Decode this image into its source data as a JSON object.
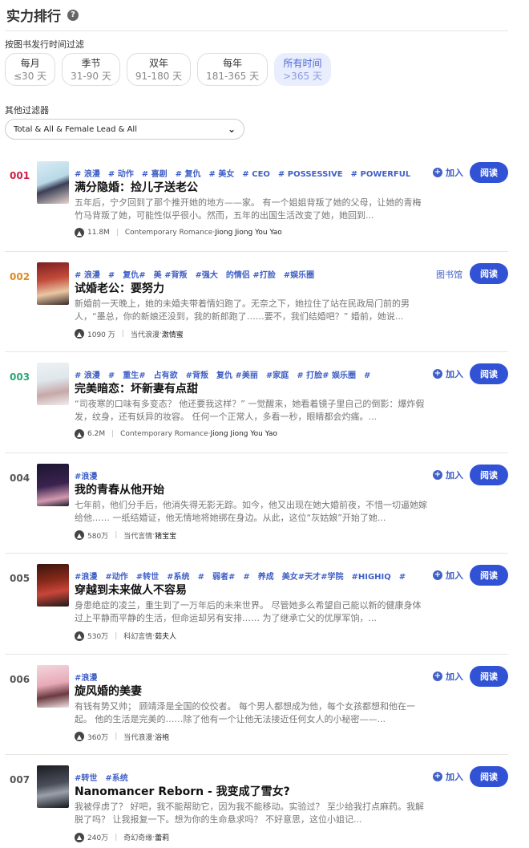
{
  "header": {
    "title": "实力排行",
    "help_icon": "?"
  },
  "time_filter": {
    "label": "按图书发行时间过滤",
    "options": [
      {
        "name": "每月",
        "range": "≤30 天",
        "active": false
      },
      {
        "name": "季节",
        "range": "31-90 天",
        "active": false
      },
      {
        "name": "双年",
        "range": "91-180 天",
        "active": false
      },
      {
        "name": "每年",
        "range": "181-365 天",
        "active": false
      },
      {
        "name": "所有时间",
        "range": ">365 天",
        "active": true
      }
    ]
  },
  "other_filter": {
    "label": "其他过滤器",
    "selected": "Total & All & Female Lead & All"
  },
  "books": [
    {
      "rank": "001",
      "rank_color": "#d0204a",
      "tags": [
        "# 浪漫",
        "# 动作",
        "# 喜剧",
        "# 复仇",
        "# 美女",
        "# CEO",
        "# POSSESSIVE",
        "# POWERFUL"
      ],
      "title": "满分隐婚：捡儿子送老公",
      "desc": "五年后，宁夕回到了那个推开她的地方——家。 有一个姐姐背叛了她的父母，让她的青梅竹马背叛了她，可能性似乎很小。然而，五年的出国生活改变了她，她回到...",
      "popularity": "11.8M",
      "genre": "Contemporary Romance",
      "author": "Jiong Jiong You Yao",
      "action": "加入",
      "read": "阅读"
    },
    {
      "rank": "002",
      "rank_color": "#e08a1e",
      "tags": [
        "# 浪漫",
        "#",
        "复仇#",
        "美 #背叛",
        "#强大",
        "的情侣 #打脸",
        "#娱乐圈"
      ],
      "title": "试婚老公：要努力",
      "desc": "新婚前一天晚上，她的未婚夫带着情妇跑了。无奈之下，她拉住了站在民政局门前的男人，“墨总，你的新娘还没到，我的新郎跑了……要不，我们结婚吧？” 婚前，她说...",
      "popularity": "1090 万",
      "genre": "当代浪漫",
      "author": "激情蜜",
      "action": "图书馆",
      "read": "阅读"
    },
    {
      "rank": "003",
      "rank_color": "#2aa876",
      "tags": [
        "# 浪漫",
        "#",
        "重生#",
        "占有欲",
        "#背叛",
        "复仇 #美丽",
        "#家庭",
        "# 打脸# 娱乐圈",
        "#"
      ],
      "title": "完美暗恋：坏新妻有点甜",
      "desc": "“司夜寒的口味有多变态？ 他还要我这样？” 一觉醒来，她看着镜子里自己的倒影：爆炸假发，纹身，还有妖异的妆容。 任何一个正常人，多看一秒，眼睛都会灼痛。...",
      "popularity": "6.2M",
      "genre": "Contemporary Romance",
      "author": "Jiong Jiong You Yao",
      "action": "加入",
      "read": "阅读"
    },
    {
      "rank": "004",
      "rank_color": "#555555",
      "tags": [
        "#浪漫"
      ],
      "title": "我的青春从他开始",
      "desc": "七年前，他们分手后，他消失得无影无踪。如今，他又出现在她大婚前夜，不惜一切逼她嫁给他…… 一纸结婚证，他无情地将她绑在身边。从此，这位“灰姑娘”开始了她...",
      "popularity": "580万",
      "genre": "当代言情",
      "author": "猪宝宝",
      "action": "加入",
      "read": "阅读"
    },
    {
      "rank": "005",
      "rank_color": "#555555",
      "tags": [
        "#浪漫",
        "#动作",
        "#转世",
        "#系统",
        "#",
        "弱者#",
        "#",
        "养成",
        "美女#天才#学院",
        "#HIGHIQ",
        "#"
      ],
      "title": "穿越到未来做人不容易",
      "desc": "身患绝症的凌兰，重生到了一万年后的未来世界。 尽管她多么希望自己能以新的健康身体过上平静而平静的生活，但命运却另有安排…… 为了继承亡父的优厚军饷，...",
      "popularity": "530万",
      "genre": "科幻言情",
      "author": "茹夫人",
      "action": "加入",
      "read": "阅读"
    },
    {
      "rank": "006",
      "rank_color": "#555555",
      "tags": [
        "#浪漫"
      ],
      "title": "旋风婚的美妻",
      "desc": "有钱有势又帅； 顾靖泽是全国的佼佼者。 每个男人都想成为他，每个女孩都想和他在一起。 他的生活是完美的……除了他有一个让他无法接近任何女人的小秘密——...",
      "popularity": "360万",
      "genre": "当代浪漫",
      "author": "浴袍",
      "action": "加入",
      "read": "阅读"
    },
    {
      "rank": "007",
      "rank_color": "#555555",
      "tags": [
        "#转世",
        "#系统"
      ],
      "title": "Nanomancer Reborn - 我变成了雪女?",
      "desc": "我被俘虏了？ 好吧，我不能帮助它，因为我不能移动。实验过？ 至少给我打点麻药。我解脱了吗？ 让我报复一下。想为你的生命悬求吗？ 不好意思，这位小姐记...",
      "popularity": "240万",
      "genre": "奇幻奇缘",
      "author": "蕾莉",
      "action": "加入",
      "read": "阅读"
    }
  ]
}
